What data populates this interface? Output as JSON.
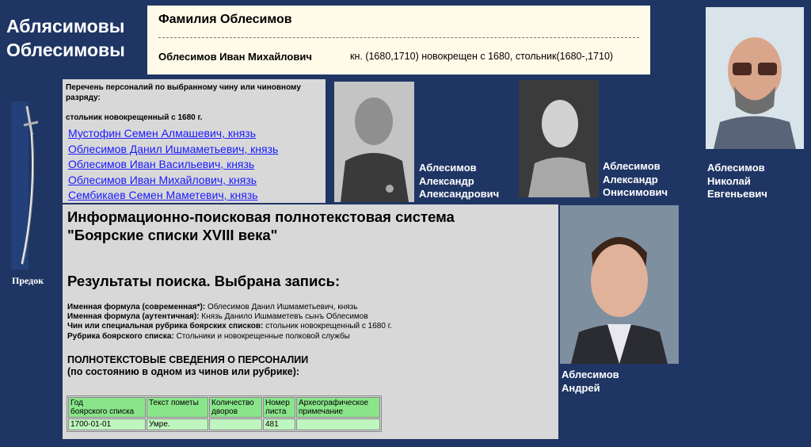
{
  "site_title_line1": "Аблясимовы",
  "site_title_line2": "Облесимовы",
  "family": {
    "heading": "Фамилия Облесимов",
    "person_name": "Облесимов Иван Михайлович",
    "person_desc": "кн. (1680,1710) новокрещен с 1680, стольник(1680-,1710)"
  },
  "ancestor": {
    "label": "Предок",
    "image_icon": "sabre-icon"
  },
  "list_panel": {
    "intro": "Перечень персоналий по выбранному чину или чиновному разряду:",
    "rank": "стольник новокрещенный с 1680 г.",
    "links": [
      "Мустофин Семен Алмашевич, князь",
      "Облесимов Данил Ишмаметьевич, князь",
      "Облесимов Иван Васильевич, князь",
      "Облесимов Иван Михайлович, князь",
      "Сембикаев Семен Маметевич, князь"
    ]
  },
  "photos": [
    {
      "line1": "Аблесимов",
      "line2": "Александр",
      "line3": "Александрович"
    },
    {
      "line1": "Аблесимов",
      "line2": "Александр",
      "line3": "Онисимович"
    },
    {
      "line1": "Аблесимов",
      "line2": "Николай",
      "line3": "Евгеньевич"
    },
    {
      "line1": "Аблесимов",
      "line2": "Андрей"
    }
  ],
  "main": {
    "title_line1": "Информационно-поисковая полнотекстовая система",
    "title_line2": "\"Боярские списки XVIII века\"",
    "results_heading": "Результаты поиска. Выбрана запись:",
    "fields": [
      {
        "label": "Именная формула (современная*):",
        "value": "Облесимов Данил Ишмаметьевич, князь"
      },
      {
        "label": "Именная формула (аутентичная):",
        "value": "Князь Данило Ишмаметевъ сынъ Облесимов"
      },
      {
        "label": "Чин или специальная рубрика боярских списков:",
        "value": "стольник новокрещенный с 1680 г."
      },
      {
        "label": "Рубрика боярского списка:",
        "value": "Стольники и новокрещенные полковой службы"
      }
    ],
    "fulltext_line1": "ПОЛНОТЕКСТОВЫЕ СВЕДЕНИЯ О ПЕРСОНАЛИИ",
    "fulltext_line2": "(по состоянию в одном из чинов или рубрике):",
    "table": {
      "headers": [
        [
          "Год",
          "боярского списка"
        ],
        [
          "Текст пометы"
        ],
        [
          "Количество",
          "дворов"
        ],
        [
          "Номер",
          "листа"
        ],
        [
          "Археографическое",
          "примечание"
        ]
      ],
      "row": [
        "1700-01-01",
        "Умре.",
        "",
        "481",
        ""
      ]
    }
  },
  "colors": {
    "background": "#1f3564",
    "panel": "#d8d8d8",
    "table_header": "#8ae58a",
    "table_row": "#bff5bf",
    "link": "#1a1aff"
  }
}
